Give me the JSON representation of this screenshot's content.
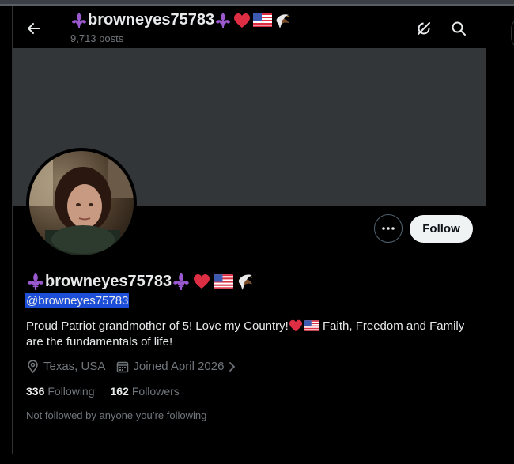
{
  "header": {
    "name": "browneyes75783",
    "post_count": "9,713 posts"
  },
  "profile": {
    "display_name": "browneyes75783",
    "handle": "@browneyes75783",
    "bio_part1": "Proud Patriot grandmother of 5! Love my Country!",
    "bio_part2": " Faith, Freedom and Family are the fundamentals of life!",
    "location": "Texas, USA",
    "joined": "Joined April 2026",
    "following_count": "336",
    "following_label": "Following",
    "followers_count": "162",
    "followers_label": "Followers",
    "not_followed_text": "Not followed by anyone you’re following"
  },
  "actions": {
    "follow_label": "Follow"
  },
  "colors": {
    "banner": "#333639",
    "follow_bg": "#eff3f4",
    "handle_highlight": "#1d4ed8",
    "muted": "#71767b"
  },
  "icons": [
    "back-arrow-icon",
    "grok-icon",
    "search-icon",
    "more-icon",
    "location-icon",
    "calendar-icon",
    "chevron-right-icon",
    "fleur-de-lis-icon",
    "heart-icon",
    "us-flag-icon",
    "eagle-icon"
  ]
}
